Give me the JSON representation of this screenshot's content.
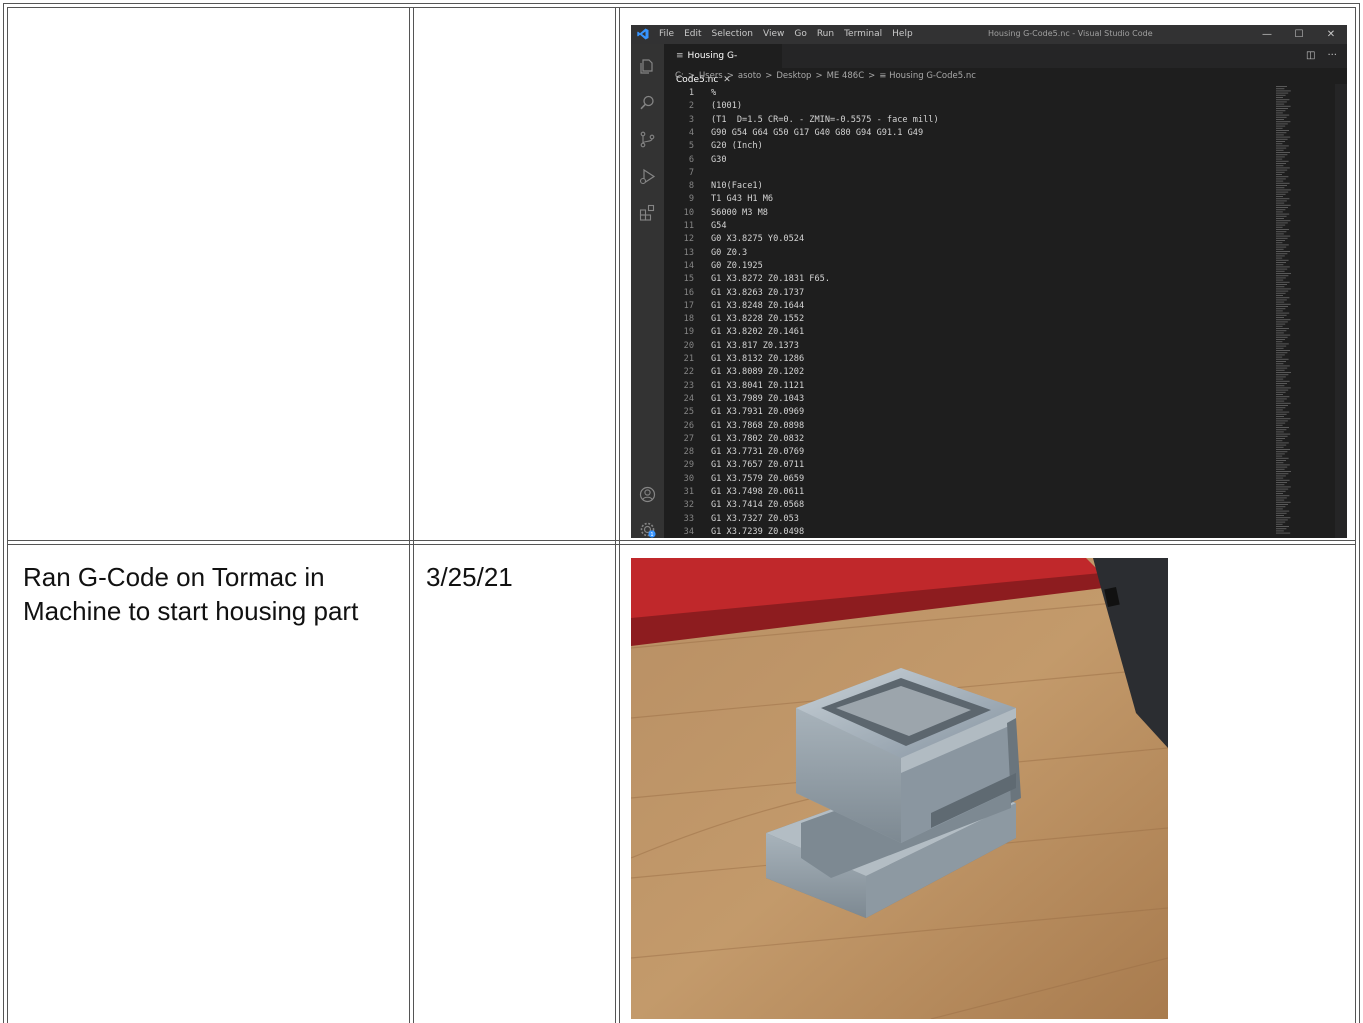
{
  "row2": {
    "description": "Ran G-Code on Tormac in Machine to start housing part",
    "date": "3/25/21"
  },
  "vscode": {
    "menu": [
      "File",
      "Edit",
      "Selection",
      "View",
      "Go",
      "Run",
      "Terminal",
      "Help"
    ],
    "window_title": "Housing G-Code5.nc - Visual Studio Code",
    "window_controls": {
      "minimize": "—",
      "maximize": "☐",
      "close": "✕"
    },
    "tab": {
      "glyph": "≡",
      "label": "Housing G-Code5.nc",
      "close": "✕"
    },
    "tab_actions": {
      "split": "◫",
      "more": "···"
    },
    "breadcrumb": [
      "C:",
      "Users",
      "asoto",
      "Desktop",
      "ME 486C",
      "≡ Housing G-Code5.nc"
    ],
    "breadcrumb_separator": ">",
    "code_lines": [
      "%",
      "(1001)",
      "(T1  D=1.5 CR=0. - ZMIN=-0.5575 - face mill)",
      "G90 G54 G64 G50 G17 G40 G80 G94 G91.1 G49",
      "G20 (Inch)",
      "G30",
      "",
      "N10(Face1)",
      "T1 G43 H1 M6",
      "S6000 M3 M8",
      "G54",
      "G0 X3.8275 Y0.0524",
      "G0 Z0.3",
      "G0 Z0.1925",
      "G1 X3.8272 Z0.1831 F65.",
      "G1 X3.8263 Z0.1737",
      "G1 X3.8248 Z0.1644",
      "G1 X3.8228 Z0.1552",
      "G1 X3.8202 Z0.1461",
      "G1 X3.817 Z0.1373",
      "G1 X3.8132 Z0.1286",
      "G1 X3.8089 Z0.1202",
      "G1 X3.8041 Z0.1121",
      "G1 X3.7989 Z0.1043",
      "G1 X3.7931 Z0.0969",
      "G1 X3.7868 Z0.0898",
      "G1 X3.7802 Z0.0832",
      "G1 X3.7731 Z0.0769",
      "G1 X3.7657 Z0.0711",
      "G1 X3.7579 Z0.0659",
      "G1 X3.7498 Z0.0611",
      "G1 X3.7414 Z0.0568",
      "G1 X3.7327 Z0.053",
      "G1 X3.7239 Z0.0498"
    ],
    "colors": {
      "editor_bg": "#1e1e1e",
      "titlebar_bg": "#323233",
      "activity_bg": "#333333",
      "accent": "#3794ff"
    },
    "activity_icons": [
      "files-icon",
      "search-icon",
      "source-control-icon",
      "run-debug-icon",
      "extensions-icon",
      "account-icon",
      "settings-gear-icon"
    ],
    "settings_badge": "1"
  },
  "photo": {
    "subject": "machined aluminum housing part on wooden workbench",
    "colors": {
      "wood": "#b98a58",
      "aluminum": "#9aa6ae",
      "red_case": "#c0282b"
    }
  }
}
